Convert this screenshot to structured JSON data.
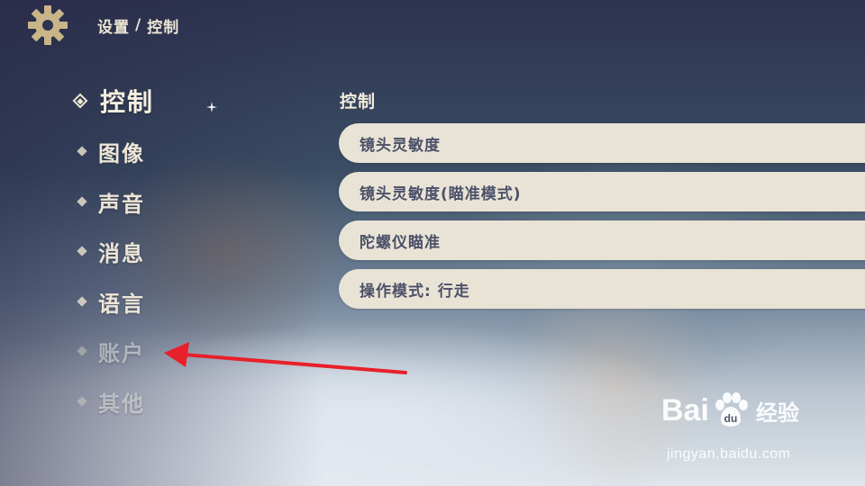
{
  "header": {
    "crumb_parent": "设置",
    "crumb_separator": "/",
    "crumb_current": "控制"
  },
  "nav": {
    "items": [
      {
        "label": "控制"
      },
      {
        "label": "图像"
      },
      {
        "label": "声音"
      },
      {
        "label": "消息"
      },
      {
        "label": "语言"
      },
      {
        "label": "账户"
      },
      {
        "label": "其他"
      }
    ]
  },
  "content": {
    "section_title": "控制",
    "options": [
      {
        "label": "镜头灵敏度"
      },
      {
        "label": "镜头灵敏度(瞄准模式)"
      },
      {
        "label": "陀螺仪瞄准"
      },
      {
        "label": "操作模式: 行走"
      }
    ]
  },
  "watermark": {
    "brand_left": "Bai",
    "brand_right": "经验",
    "url": "jingyan.baidu.com"
  },
  "icons": {
    "gear": "gear-icon",
    "arrow": "red-arrow-annotation",
    "sparkle": "sparkle-icon"
  },
  "colors": {
    "panel_bg": "#e9e3d6",
    "panel_text": "#4b5168",
    "nav_text": "#ece6d6",
    "arrow": "#e8202a"
  }
}
